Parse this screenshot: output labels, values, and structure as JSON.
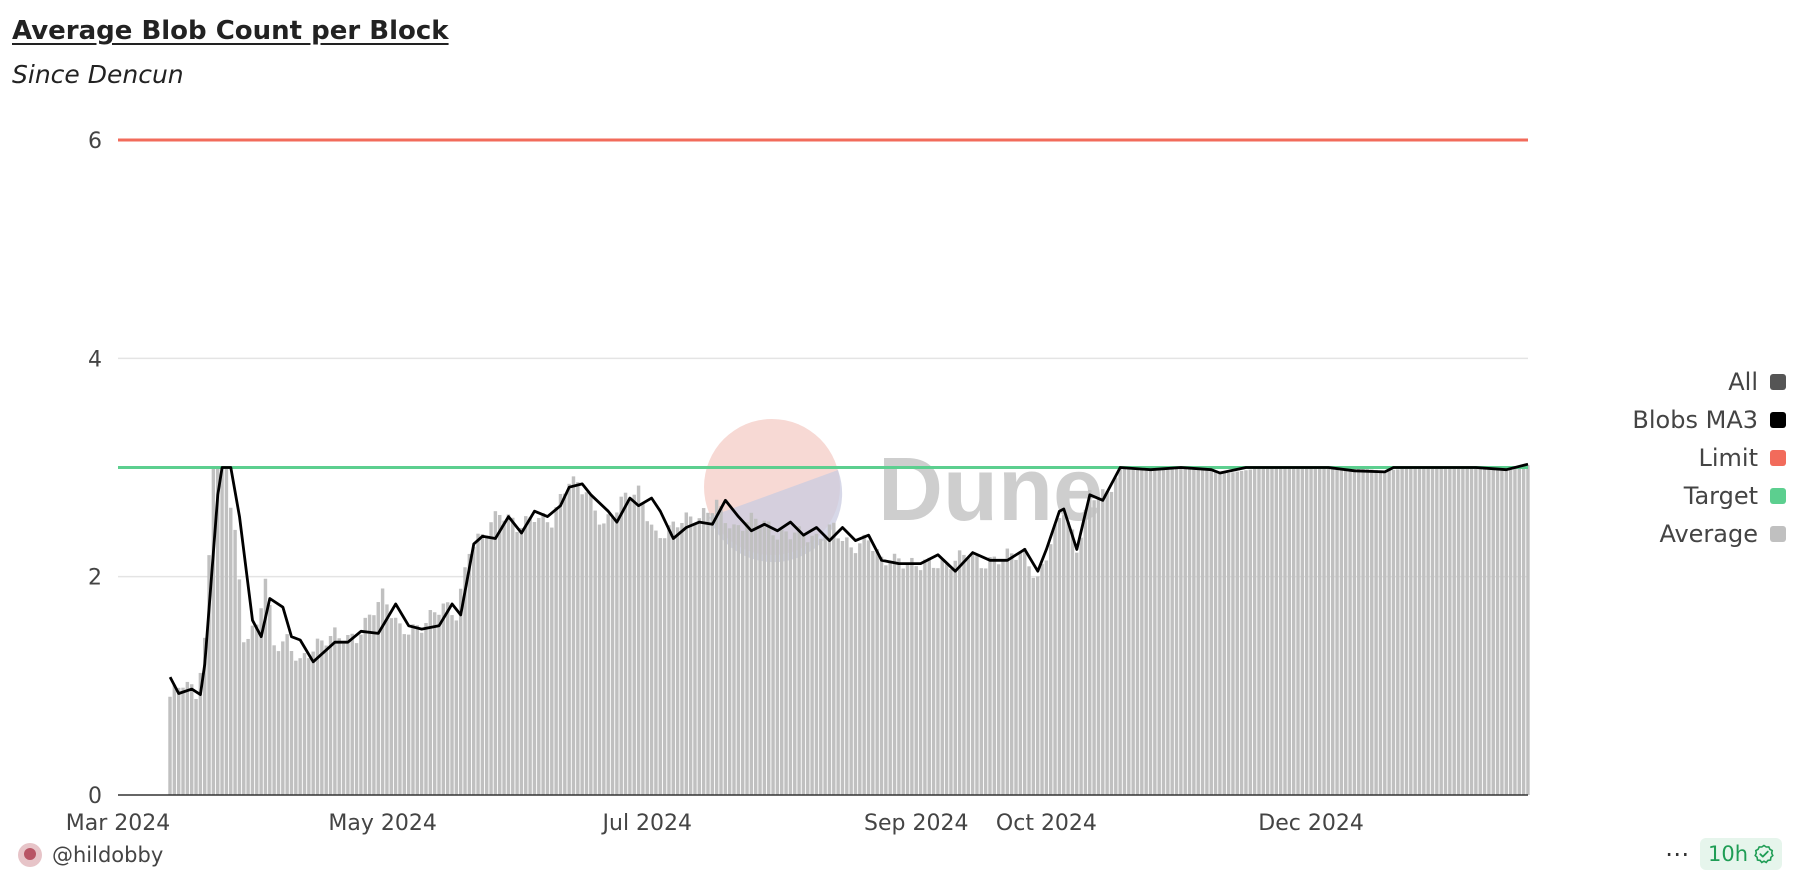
{
  "header": {
    "title": "Average Blob Count per Block",
    "subtitle": "Since Dencun"
  },
  "footer": {
    "author": "@hildobby",
    "more_label": "⋯",
    "freshness": "10h",
    "check_icon": "check-circle-icon",
    "avatar_icon": "avatar-icon"
  },
  "watermark": {
    "text": "Dune"
  },
  "legend": [
    {
      "label": "All",
      "color": "#555555"
    },
    {
      "label": "Blobs MA3",
      "color": "#000000"
    },
    {
      "label": "Limit",
      "color": "#f26b5b"
    },
    {
      "label": "Target",
      "color": "#5ccf8f"
    },
    {
      "label": "Average",
      "color": "#c0c0c0"
    }
  ],
  "chart_data": {
    "type": "bar",
    "title": "Average Blob Count per Block",
    "subtitle": "Since Dencun",
    "x_range": [
      "2024-03-13",
      "2025-01-20"
    ],
    "x_ticks": [
      "Mar 2024",
      "May 2024",
      "Jul 2024",
      "Sep 2024",
      "Oct 2024",
      "Dec 2024"
    ],
    "x_tick_dates": [
      "2024-03-01",
      "2024-05-01",
      "2024-07-01",
      "2024-09-01",
      "2024-10-01",
      "2024-12-01"
    ],
    "ylim": [
      0,
      6
    ],
    "y_ticks": [
      0,
      2,
      4,
      6
    ],
    "grid": true,
    "legend_position": "right",
    "reference_lines": [
      {
        "name": "Limit",
        "value": 6,
        "color": "#f26b5b"
      },
      {
        "name": "Target",
        "value": 3,
        "color": "#5ccf8f"
      }
    ],
    "series": [
      {
        "name": "Average",
        "style": "bar",
        "color": "#c0c0c0",
        "points": [
          [
            "2024-03-13",
            0.9
          ],
          [
            "2024-03-16",
            1.0
          ],
          [
            "2024-03-19",
            0.9
          ],
          [
            "2024-03-21",
            1.4
          ],
          [
            "2024-03-23",
            3.0
          ],
          [
            "2024-03-26",
            3.0
          ],
          [
            "2024-03-28",
            2.4
          ],
          [
            "2024-03-30",
            1.4
          ],
          [
            "2024-04-02",
            1.5
          ],
          [
            "2024-04-04",
            2.0
          ],
          [
            "2024-04-06",
            1.4
          ],
          [
            "2024-04-09",
            1.45
          ],
          [
            "2024-04-12",
            1.2
          ],
          [
            "2024-04-15",
            1.3
          ],
          [
            "2024-04-20",
            1.5
          ],
          [
            "2024-04-25",
            1.45
          ],
          [
            "2024-04-28",
            1.6
          ],
          [
            "2024-05-01",
            1.8
          ],
          [
            "2024-05-05",
            1.55
          ],
          [
            "2024-05-10",
            1.55
          ],
          [
            "2024-05-15",
            1.7
          ],
          [
            "2024-05-18",
            1.65
          ],
          [
            "2024-05-21",
            2.3
          ],
          [
            "2024-05-24",
            2.4
          ],
          [
            "2024-05-28",
            2.55
          ],
          [
            "2024-06-01",
            2.45
          ],
          [
            "2024-06-05",
            2.6
          ],
          [
            "2024-06-09",
            2.5
          ],
          [
            "2024-06-13",
            2.85
          ],
          [
            "2024-06-17",
            2.8
          ],
          [
            "2024-06-21",
            2.5
          ],
          [
            "2024-06-26",
            2.7
          ],
          [
            "2024-06-29",
            2.75
          ],
          [
            "2024-07-03",
            2.4
          ],
          [
            "2024-07-08",
            2.5
          ],
          [
            "2024-07-13",
            2.5
          ],
          [
            "2024-07-17",
            2.7
          ],
          [
            "2024-07-21",
            2.45
          ],
          [
            "2024-07-26",
            2.5
          ],
          [
            "2024-07-31",
            2.4
          ],
          [
            "2024-08-04",
            2.45
          ],
          [
            "2024-08-09",
            2.3
          ],
          [
            "2024-08-13",
            2.45
          ],
          [
            "2024-08-17",
            2.3
          ],
          [
            "2024-08-21",
            2.35
          ],
          [
            "2024-08-24",
            2.1
          ],
          [
            "2024-08-28",
            2.15
          ],
          [
            "2024-09-03",
            2.15
          ],
          [
            "2024-09-08",
            2.05
          ],
          [
            "2024-09-13",
            2.25
          ],
          [
            "2024-09-16",
            2.15
          ],
          [
            "2024-09-21",
            2.15
          ],
          [
            "2024-09-26",
            2.2
          ],
          [
            "2024-09-29",
            2.0
          ],
          [
            "2024-10-02",
            2.35
          ],
          [
            "2024-10-05",
            2.6
          ],
          [
            "2024-10-08",
            2.2
          ],
          [
            "2024-10-11",
            2.75
          ],
          [
            "2024-10-15",
            2.8
          ],
          [
            "2024-10-18",
            3.0
          ],
          [
            "2024-10-24",
            3.0
          ],
          [
            "2024-11-02",
            3.0
          ],
          [
            "2024-11-12",
            2.95
          ],
          [
            "2024-11-20",
            3.0
          ],
          [
            "2024-12-02",
            3.0
          ],
          [
            "2024-12-10",
            3.0
          ],
          [
            "2024-12-18",
            2.97
          ],
          [
            "2024-12-25",
            3.0
          ],
          [
            "2025-01-05",
            3.0
          ],
          [
            "2025-01-13",
            2.98
          ],
          [
            "2025-01-20",
            3.02
          ]
        ]
      },
      {
        "name": "Blobs MA3",
        "style": "line",
        "color": "#000000",
        "points": [
          [
            "2024-03-13",
            1.08
          ],
          [
            "2024-03-15",
            0.93
          ],
          [
            "2024-03-18",
            0.97
          ],
          [
            "2024-03-20",
            0.92
          ],
          [
            "2024-03-21",
            1.2
          ],
          [
            "2024-03-24",
            2.75
          ],
          [
            "2024-03-25",
            3.0
          ],
          [
            "2024-03-27",
            3.0
          ],
          [
            "2024-03-29",
            2.55
          ],
          [
            "2024-04-01",
            1.6
          ],
          [
            "2024-04-03",
            1.45
          ],
          [
            "2024-04-05",
            1.8
          ],
          [
            "2024-04-08",
            1.72
          ],
          [
            "2024-04-10",
            1.45
          ],
          [
            "2024-04-12",
            1.42
          ],
          [
            "2024-04-15",
            1.22
          ],
          [
            "2024-04-20",
            1.4
          ],
          [
            "2024-04-23",
            1.4
          ],
          [
            "2024-04-26",
            1.5
          ],
          [
            "2024-04-30",
            1.48
          ],
          [
            "2024-05-04",
            1.75
          ],
          [
            "2024-05-07",
            1.55
          ],
          [
            "2024-05-10",
            1.52
          ],
          [
            "2024-05-14",
            1.55
          ],
          [
            "2024-05-17",
            1.75
          ],
          [
            "2024-05-19",
            1.65
          ],
          [
            "2024-05-22",
            2.3
          ],
          [
            "2024-05-24",
            2.37
          ],
          [
            "2024-05-27",
            2.35
          ],
          [
            "2024-05-30",
            2.55
          ],
          [
            "2024-06-02",
            2.4
          ],
          [
            "2024-06-05",
            2.6
          ],
          [
            "2024-06-08",
            2.55
          ],
          [
            "2024-06-11",
            2.65
          ],
          [
            "2024-06-13",
            2.82
          ],
          [
            "2024-06-16",
            2.85
          ],
          [
            "2024-06-18",
            2.75
          ],
          [
            "2024-06-22",
            2.6
          ],
          [
            "2024-06-24",
            2.5
          ],
          [
            "2024-06-27",
            2.72
          ],
          [
            "2024-06-29",
            2.65
          ],
          [
            "2024-07-02",
            2.72
          ],
          [
            "2024-07-04",
            2.6
          ],
          [
            "2024-07-07",
            2.35
          ],
          [
            "2024-07-10",
            2.45
          ],
          [
            "2024-07-13",
            2.5
          ],
          [
            "2024-07-16",
            2.48
          ],
          [
            "2024-07-19",
            2.7
          ],
          [
            "2024-07-22",
            2.55
          ],
          [
            "2024-07-25",
            2.42
          ],
          [
            "2024-07-28",
            2.48
          ],
          [
            "2024-07-31",
            2.42
          ],
          [
            "2024-08-03",
            2.5
          ],
          [
            "2024-08-06",
            2.38
          ],
          [
            "2024-08-09",
            2.45
          ],
          [
            "2024-08-12",
            2.33
          ],
          [
            "2024-08-15",
            2.45
          ],
          [
            "2024-08-18",
            2.33
          ],
          [
            "2024-08-21",
            2.38
          ],
          [
            "2024-08-24",
            2.15
          ],
          [
            "2024-08-28",
            2.12
          ],
          [
            "2024-09-02",
            2.12
          ],
          [
            "2024-09-06",
            2.2
          ],
          [
            "2024-09-10",
            2.05
          ],
          [
            "2024-09-14",
            2.22
          ],
          [
            "2024-09-18",
            2.15
          ],
          [
            "2024-09-22",
            2.15
          ],
          [
            "2024-09-26",
            2.25
          ],
          [
            "2024-09-29",
            2.05
          ],
          [
            "2024-10-01",
            2.25
          ],
          [
            "2024-10-04",
            2.6
          ],
          [
            "2024-10-05",
            2.62
          ],
          [
            "2024-10-08",
            2.25
          ],
          [
            "2024-10-11",
            2.75
          ],
          [
            "2024-10-14",
            2.7
          ],
          [
            "2024-10-18",
            3.0
          ],
          [
            "2024-10-25",
            2.98
          ],
          [
            "2024-11-01",
            3.0
          ],
          [
            "2024-11-08",
            2.98
          ],
          [
            "2024-11-10",
            2.95
          ],
          [
            "2024-11-16",
            3.0
          ],
          [
            "2024-11-25",
            3.0
          ],
          [
            "2024-12-05",
            3.0
          ],
          [
            "2024-12-11",
            2.97
          ],
          [
            "2024-12-18",
            2.96
          ],
          [
            "2024-12-20",
            3.0
          ],
          [
            "2024-12-30",
            3.0
          ],
          [
            "2025-01-08",
            3.0
          ],
          [
            "2025-01-15",
            2.98
          ],
          [
            "2025-01-20",
            3.03
          ]
        ]
      }
    ]
  }
}
